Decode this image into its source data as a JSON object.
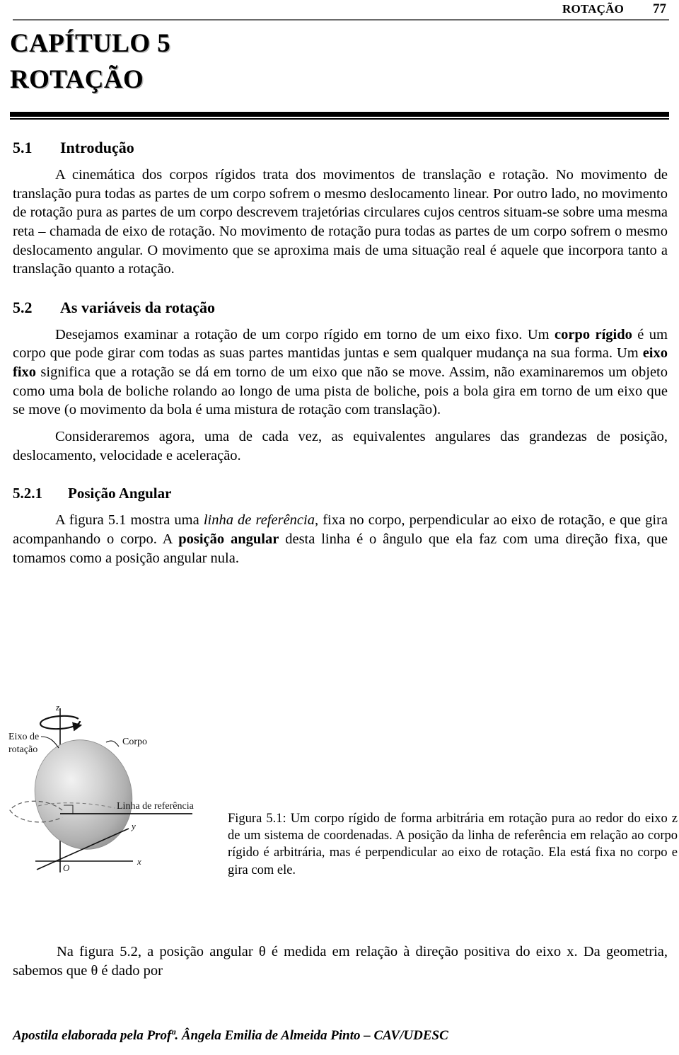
{
  "header": {
    "title": "ROTAÇÃO",
    "page_number": "77"
  },
  "chapter": {
    "line1": "CAPÍTULO 5",
    "line2": "ROTAÇÃO"
  },
  "sections": {
    "s51": {
      "number": "5.1",
      "label": "Introdução",
      "paragraph": "A cinemática dos corpos rígidos trata dos movimentos de translação e rotação. No movimento de translação pura todas as partes de um corpo sofrem o mesmo deslocamento linear. Por outro lado, no movimento de rotação pura as partes de um corpo descrevem trajetórias circulares cujos centros situam-se sobre uma mesma reta – chamada de eixo de rotação. No movimento de rotação pura todas as partes de um corpo sofrem o mesmo deslocamento angular. O movimento que se aproxima mais de uma situação real é aquele que incorpora tanto a translação quanto a rotação."
    },
    "s52": {
      "number": "5.2",
      "label": "As variáveis da rotação",
      "p1_a": "Desejamos examinar a rotação de um corpo rígido em torno de um eixo fixo. Um ",
      "p1_b_bold1": "corpo rígido",
      "p1_c": " é um corpo que pode girar com todas as suas partes mantidas juntas e sem qualquer mudança na sua forma. Um ",
      "p1_d_bold2": "eixo fixo",
      "p1_e": " significa que a rotação se dá em torno de um eixo que não se move. Assim, não examinaremos um objeto como uma bola de boliche rolando ao longo de uma pista de boliche, pois a bola gira em torno de um eixo que se move (o movimento da bola é uma mistura de rotação com translação).",
      "p2": "Consideraremos agora, uma de cada vez, as equivalentes angulares das grandezas de posição, deslocamento, velocidade e aceleração."
    },
    "s521": {
      "number": "5.2.1",
      "label": "Posição Angular",
      "p1_a": "A figura 5.1 mostra uma ",
      "p1_b_italic": "linha de referência",
      "p1_c": ", fixa no corpo, perpendicular ao eixo de rotação, e que gira acompanhando o corpo. A ",
      "p1_d_bold": "posição angular",
      "p1_e": " desta linha é o ângulo que ela faz com uma direção fixa, que tomamos como a posição angular nula."
    }
  },
  "figure": {
    "caption": "Figura 5.1: Um corpo rígido de forma arbitrária em rotação pura ao redor do eixo z de um sistema de coordenadas. A posição da linha de referência em relação ao corpo rígido é arbitrária, mas é perpendicular ao eixo de rotação. Ela está fixa no corpo e gira com ele.",
    "labels": {
      "axis_of_rotation_line1": "Eixo de",
      "axis_of_rotation_line2": "rotação",
      "body": "Corpo",
      "reference_line": "Linha de referência",
      "axis_z": "z",
      "axis_y": "y",
      "axis_x": "x",
      "origin": "O"
    }
  },
  "closing": {
    "paragraph_a": "Na figura 5.2, a posição angular ",
    "theta1": "θ",
    "paragraph_b": " é medida em relação à direção positiva do eixo x. Da geometria, sabemos que ",
    "theta2": "θ",
    "paragraph_c": " é dado por"
  },
  "footer": {
    "text": "Apostila elaborada pela Profª. Ângela Emilia de Almeida Pinto – CAV/UDESC"
  },
  "colors": {
    "header_rule": "#6b6b6b",
    "title_rule": "#000000",
    "text": "#000000",
    "figure_body_fill": "#b9b9b9"
  }
}
